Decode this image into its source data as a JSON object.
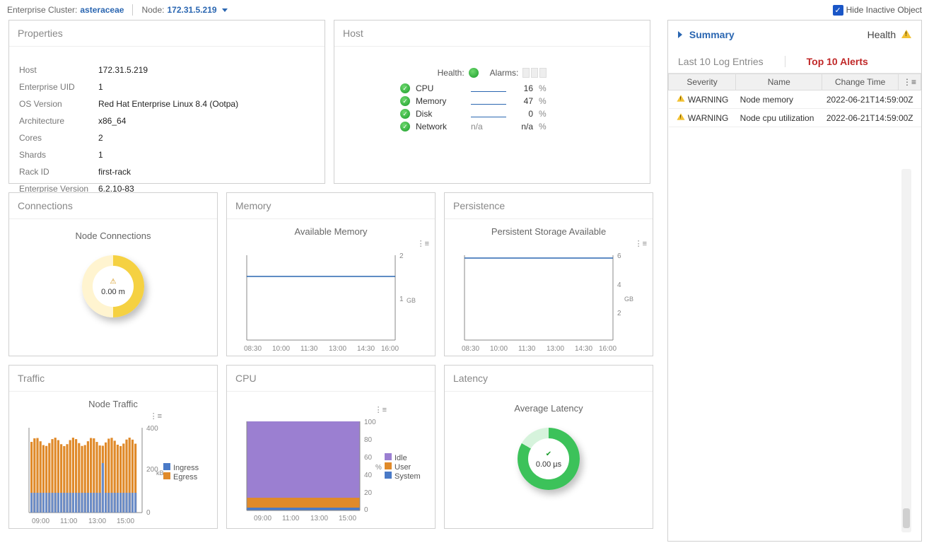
{
  "topbar": {
    "cluster_label": "Enterprise Cluster:",
    "cluster_value": "asteraceae",
    "node_label": "Node:",
    "node_value": "172.31.5.219",
    "hide_inactive_label": "Hide Inactive Object"
  },
  "properties": {
    "title": "Properties",
    "rows": [
      {
        "k": "Host",
        "v": "172.31.5.219"
      },
      {
        "k": "Enterprise UID",
        "v": "1"
      },
      {
        "k": "OS Version",
        "v": "Red Hat Enterprise Linux 8.4 (Ootpa)"
      },
      {
        "k": "Architecture",
        "v": "x86_64"
      },
      {
        "k": "Cores",
        "v": "2"
      },
      {
        "k": "Shards",
        "v": "1"
      },
      {
        "k": "Rack ID",
        "v": "first-rack"
      },
      {
        "k": "Enterprise Version",
        "v": "6.2.10-83"
      }
    ]
  },
  "host": {
    "title": "Host",
    "health_label": "Health:",
    "alarms_label": "Alarms:",
    "metrics": [
      {
        "name": "CPU",
        "value": "16",
        "spark": true
      },
      {
        "name": "Memory",
        "value": "47",
        "spark": true
      },
      {
        "name": "Disk",
        "value": "0",
        "spark": true
      },
      {
        "name": "Network",
        "value": "n/a",
        "spark": false,
        "na": "n/a"
      }
    ],
    "pct": "%"
  },
  "connections": {
    "title": "Connections",
    "subtitle": "Node Connections",
    "value": "0.00 m"
  },
  "memory_panel": {
    "title": "Memory",
    "subtitle": "Available Memory"
  },
  "persistence_panel": {
    "title": "Persistence",
    "subtitle": "Persistent Storage Available"
  },
  "traffic": {
    "title": "Traffic",
    "subtitle": "Node Traffic",
    "legend": [
      "Ingress",
      "Egress"
    ]
  },
  "cpu_panel": {
    "title": "CPU",
    "legend": [
      "Idle",
      "User",
      "System"
    ]
  },
  "latency_panel": {
    "title": "Latency",
    "subtitle": "Average Latency",
    "value": "0.00 µs"
  },
  "summary": {
    "title": "Summary",
    "health_label": "Health",
    "tab_log": "Last 10 Log Entries",
    "tab_alerts": "Top 10 Alerts",
    "columns": [
      "Severity",
      "Name",
      "Change Time"
    ],
    "alerts": [
      {
        "severity": "WARNING",
        "name": "Node memory",
        "time": "2022-06-21T14:59:00Z"
      },
      {
        "severity": "WARNING",
        "name": "Node cpu utilization",
        "time": "2022-06-21T14:59:00Z"
      }
    ]
  },
  "chart_data": [
    {
      "id": "available-memory",
      "type": "line",
      "title": "Available Memory",
      "x": [
        "08:30",
        "10:00",
        "11:30",
        "13:00",
        "14:30",
        "16:00"
      ],
      "series": [
        {
          "name": "Available Memory (GB)",
          "values": [
            1.5,
            1.5,
            1.5,
            1.5,
            1.5,
            1.5
          ]
        }
      ],
      "ylabel": "GB",
      "ylim": [
        0,
        2
      ],
      "yticks": [
        1,
        2
      ]
    },
    {
      "id": "persistent-storage",
      "type": "line",
      "title": "Persistent Storage Available",
      "x": [
        "08:30",
        "10:00",
        "11:30",
        "13:00",
        "14:30",
        "16:00"
      ],
      "series": [
        {
          "name": "Persistent Storage (GB)",
          "values": [
            5.8,
            5.8,
            5.8,
            5.8,
            5.8,
            5.8
          ]
        }
      ],
      "ylabel": "GB",
      "ylim": [
        0,
        6
      ],
      "yticks": [
        2,
        4,
        6
      ]
    },
    {
      "id": "node-traffic",
      "type": "bar",
      "title": "Node Traffic",
      "x": [
        "09:00",
        "11:00",
        "13:00",
        "15:00"
      ],
      "series": [
        {
          "name": "Ingress",
          "values_approx": 110
        },
        {
          "name": "Egress",
          "values_approx": 350
        }
      ],
      "ylabel": "kB",
      "ylim": [
        0,
        400
      ],
      "yticks": [
        0,
        200,
        400
      ],
      "legend": [
        "Ingress",
        "Egress"
      ]
    },
    {
      "id": "cpu",
      "type": "area",
      "title": "CPU",
      "x": [
        "09:00",
        "11:00",
        "13:00",
        "15:00"
      ],
      "series": [
        {
          "name": "Idle",
          "values": [
            85,
            85,
            85,
            85
          ]
        },
        {
          "name": "User",
          "values": [
            12,
            12,
            12,
            12
          ]
        },
        {
          "name": "System",
          "values": [
            3,
            3,
            3,
            3
          ]
        }
      ],
      "ylabel": "%",
      "ylim": [
        0,
        100
      ],
      "yticks": [
        0,
        20,
        40,
        60,
        80,
        100
      ],
      "legend": [
        "Idle",
        "User",
        "System"
      ]
    }
  ]
}
